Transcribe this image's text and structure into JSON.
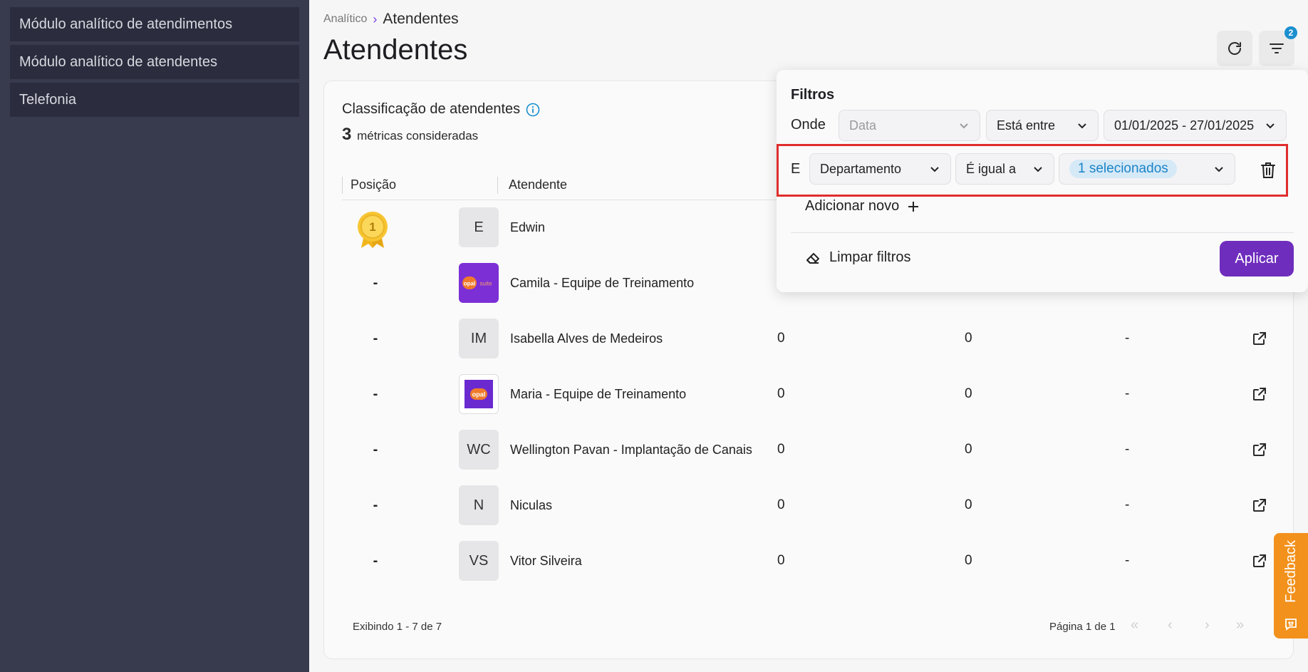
{
  "sidebar": {
    "items": [
      {
        "label": "Módulo analítico de atendimentos"
      },
      {
        "label": "Módulo analítico de atendentes"
      },
      {
        "label": "Telefonia"
      }
    ]
  },
  "breadcrumb": {
    "root": "Analítico",
    "current": "Atendentes"
  },
  "page_title": "Atendentes",
  "header": {
    "filter_badge_count": "2"
  },
  "ranking": {
    "title": "Classificação de atendentes",
    "metrics_count": "3",
    "metrics_label": "métricas consideradas",
    "columns": {
      "position": "Posição",
      "agent": "Atendente"
    },
    "rows": [
      {
        "position": "1",
        "initials": "E",
        "name": "Edwin",
        "v1": "",
        "v2": "",
        "v3": ""
      },
      {
        "position": "-",
        "initials": "opal suite",
        "name": "Camila - Equipe de Treinamento",
        "v1": "",
        "v2": "",
        "v3": ""
      },
      {
        "position": "-",
        "initials": "IM",
        "name": "Isabella Alves de Medeiros",
        "v1": "0",
        "v2": "0",
        "v3": "-"
      },
      {
        "position": "-",
        "initials": "opal",
        "name": "Maria - Equipe de Treinamento",
        "v1": "0",
        "v2": "0",
        "v3": "-"
      },
      {
        "position": "-",
        "initials": "WC",
        "name": "Wellington Pavan - Implantação de Canais",
        "v1": "0",
        "v2": "0",
        "v3": "-"
      },
      {
        "position": "-",
        "initials": "N",
        "name": "Niculas",
        "v1": "0",
        "v2": "0",
        "v3": "-"
      },
      {
        "position": "-",
        "initials": "VS",
        "name": "Vitor Silveira",
        "v1": "0",
        "v2": "0",
        "v3": "-"
      }
    ],
    "footer": {
      "showing": "Exibindo 1 - 7 de 7",
      "page": "Página 1 de 1"
    },
    "pager": {
      "first": "«",
      "prev": "‹",
      "next": "›",
      "last": "»"
    }
  },
  "filters": {
    "title": "Filtros",
    "row1": {
      "connector": "Onde",
      "field": "Data",
      "operator": "Está entre",
      "value": "01/01/2025 - 27/01/2025"
    },
    "row2": {
      "connector": "E",
      "field": "Departamento",
      "operator": "É igual a",
      "value": "1 selecionados"
    },
    "add_new": "Adicionar novo",
    "clear": "Limpar filtros",
    "apply": "Aplicar"
  },
  "feedback": {
    "label": "Feedback"
  },
  "colors": {
    "accent": "#6f2dbd",
    "badge": "#1a8fd0",
    "feedback": "#f2911c",
    "highlight": "#e02d2d"
  }
}
